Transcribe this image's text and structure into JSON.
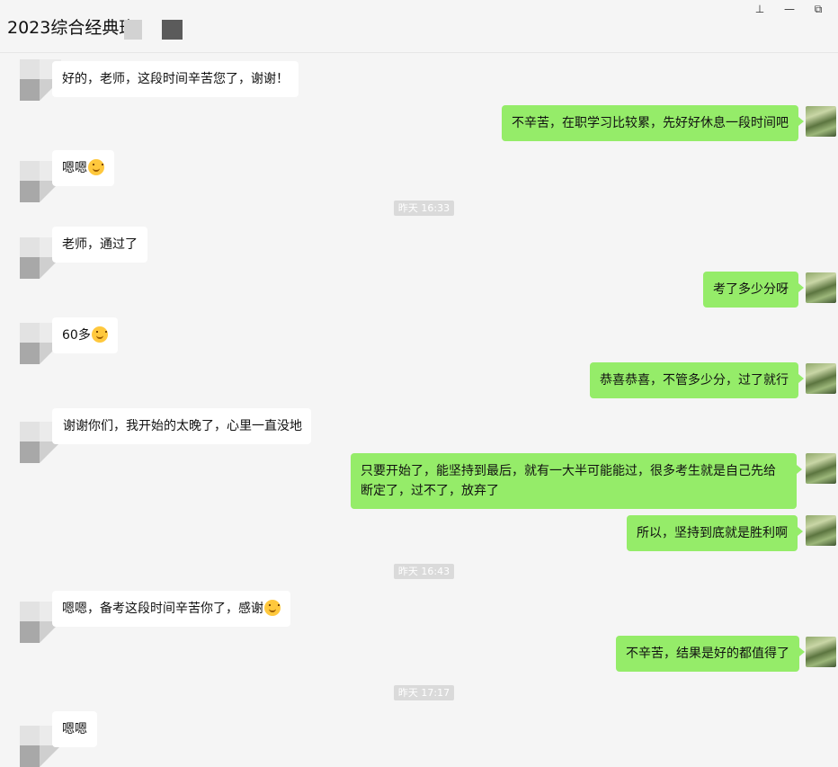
{
  "window": {
    "title": "2023综合经典班",
    "controls": {
      "pin": "⊥",
      "minimize": "—",
      "maximize": "⧉"
    }
  },
  "chat": {
    "messages": [
      {
        "dir": "in",
        "text": "好的，老师，这段时间辛苦您了，谢谢！"
      },
      {
        "dir": "out",
        "text": "不辛苦，在职学习比较累，先好好休息一段时间吧"
      },
      {
        "dir": "in",
        "text": "嗯嗯",
        "emoji": "smile-emoji"
      },
      {
        "dir": "time",
        "text": "昨天 16:33"
      },
      {
        "dir": "in",
        "text": "老师，通过了"
      },
      {
        "dir": "out",
        "text": "考了多少分呀"
      },
      {
        "dir": "in",
        "text": "60多",
        "emoji": "laugh-emoji"
      },
      {
        "dir": "out",
        "text": "恭喜恭喜，不管多少分，过了就行"
      },
      {
        "dir": "in",
        "text": "谢谢你们，我开始的太晚了，心里一直没地"
      },
      {
        "dir": "out",
        "text": "只要开始了，能坚持到最后，就有一大半可能能过，很多考生就是自己先给断定了，过不了，放弃了"
      },
      {
        "dir": "out",
        "text": "所以，坚持到底就是胜利啊"
      },
      {
        "dir": "time",
        "text": "昨天 16:43"
      },
      {
        "dir": "in",
        "text": "嗯嗯，备考这段时间辛苦你了，感谢",
        "emoji": "smile-emoji"
      },
      {
        "dir": "out",
        "text": "不辛苦，结果是好的都值得了"
      },
      {
        "dir": "time",
        "text": "昨天 17:17"
      },
      {
        "dir": "in",
        "text": "嗯嗯"
      }
    ]
  }
}
